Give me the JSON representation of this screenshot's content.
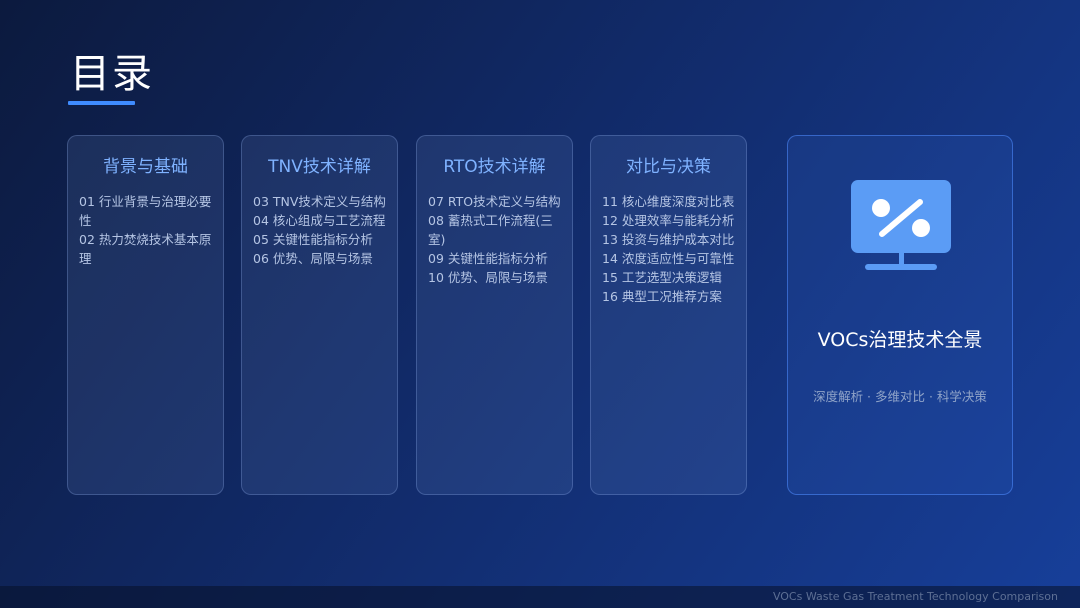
{
  "title": "目录",
  "cards": [
    {
      "title": "背景与基础",
      "items": [
        "01 行业背景与治理必要性",
        "02 热力焚烧技术基本原理"
      ]
    },
    {
      "title": "TNV技术详解",
      "items": [
        "03 TNV技术定义与结构",
        "04 核心组成与工艺流程",
        "05 关键性能指标分析",
        "06 优势、局限与场景"
      ]
    },
    {
      "title": "RTO技术详解",
      "items": [
        "07 RTO技术定义与结构",
        "08 蓄热式工作流程(三室)",
        "09 关键性能指标分析",
        "10 优势、局限与场景"
      ]
    },
    {
      "title": "对比与决策",
      "items": [
        "11 核心维度深度对比表",
        "12 处理效率与能耗分析",
        "13 投资与维护成本对比",
        "14 浓度适应性与可靠性",
        "15 工艺选型决策逻辑",
        "16 典型工况推荐方案"
      ]
    }
  ],
  "feature": {
    "icon": "percent-monitor-icon",
    "title": "VOCs治理技术全景",
    "subtitle": "深度解析 · 多维对比 · 科学决策"
  },
  "footer": {
    "text": "VOCs Waste Gas Treatment Technology Comparison"
  },
  "colors": {
    "accent": "#3f8cff",
    "card_title": "#7fb2ff",
    "icon": "#5b9cf5"
  }
}
